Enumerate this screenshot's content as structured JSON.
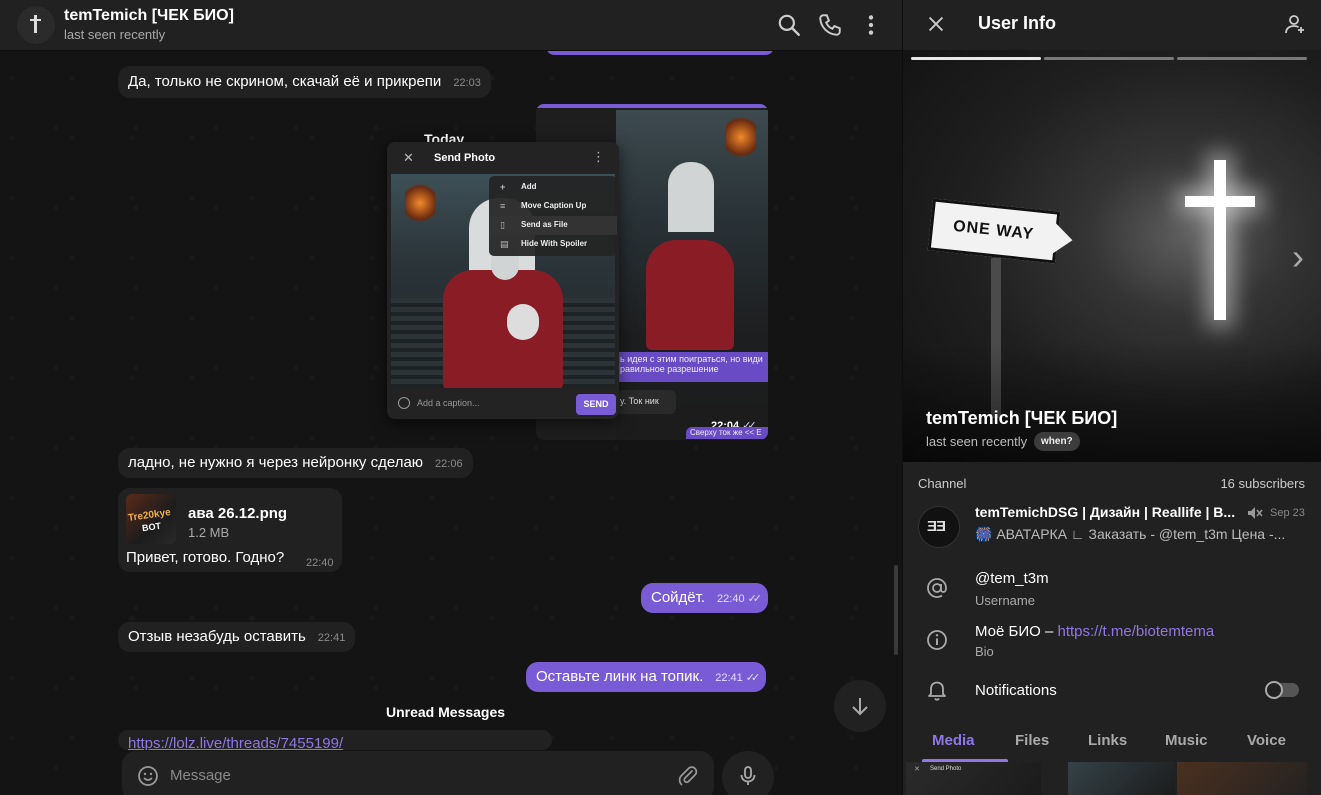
{
  "chat": {
    "header": {
      "title": "temTemich [ЧЕК БИО]",
      "status": "last seen recently"
    },
    "messages": {
      "m1": {
        "text": "Да, только не скрином, скачай её и прикрепи",
        "time": "22:03"
      },
      "today_label": "Today",
      "shot_time": "22:04",
      "shot_strip1": "ь идея с этим поиграться, но види",
      "shot_strip2": "равильное разрешение",
      "shot_strip3": "у. Ток ник",
      "shot_strip4": "Сверху ток же << E",
      "m2": {
        "text": "ладно, не нужно я через нейронку сделаю",
        "time": "22:06"
      },
      "file": {
        "name": "ава 26.12.png",
        "size": "1.2 MB",
        "caption": "Привет, готово. Годно?",
        "time": "22:40",
        "thumb_text1": "Tre20kye",
        "thumb_text2": "BOT"
      },
      "m3": {
        "text": "Сойдёт.",
        "time": "22:40"
      },
      "m4": {
        "text": "Отзыв незабудь оставить",
        "time": "22:41"
      },
      "m5": {
        "text": "Оставьте линк на топик.",
        "time": "22:41"
      },
      "unread_label": "Unread Messages",
      "partial_link": "https://lolz.live/threads/7455199/"
    },
    "send_photo_dialog": {
      "title": "Send Photo",
      "menu": [
        "Add",
        "Move Caption Up",
        "Send as File",
        "Hide With Spoiler"
      ],
      "caption_placeholder": "Add a caption...",
      "send_label": "SEND"
    },
    "composer": {
      "placeholder": "Message"
    }
  },
  "user_info": {
    "title": "User Info",
    "name": "temTemich [ЧЕК БИО]",
    "status": "last seen recently",
    "when_label": "when?",
    "photo_sign_text": "ONE WAY",
    "channel": {
      "section_label": "Channel",
      "subscribers": "16 subscribers",
      "name": "temTemichDSG | Дизайн | Reallife | B...",
      "date": "Sep 23",
      "preview": "🎆 АВАТАРКА ∟ Заказать - @tem_t3m Цена -...",
      "avatar_text": "ƎƎ"
    },
    "username": {
      "value": "@tem_t3m",
      "label": "Username"
    },
    "bio": {
      "prefix": "Моё БИО – ",
      "link": "https://t.me/biotemtema",
      "label": "Bio"
    },
    "notifications": {
      "label": "Notifications",
      "enabled": false
    },
    "tabs": [
      "Media",
      "Files",
      "Links",
      "Music",
      "Voice"
    ],
    "active_tab": "Media",
    "dialog_thumb_title": "Send Photo"
  },
  "colors": {
    "accent": "#7a5bd6",
    "link": "#8f78e6",
    "panel": "#212121",
    "background": "#121212"
  }
}
